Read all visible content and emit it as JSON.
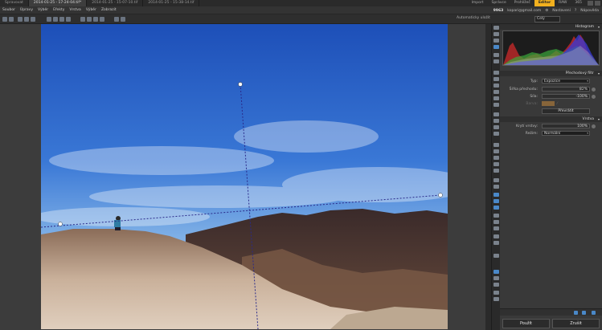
{
  "tabs": [
    {
      "label": "Spravovat",
      "active": false
    },
    {
      "label": "2014-01-25 - 17-24-04.tif*",
      "active": true
    },
    {
      "label": "2014-01-25 - 15-07-10.tif",
      "active": false
    },
    {
      "label": "2014-01-25 - 15-38-14.tif",
      "active": false
    }
  ],
  "modes": [
    {
      "label": "Import",
      "active": false
    },
    {
      "label": "Správce",
      "active": false
    },
    {
      "label": "Prohlížeč",
      "active": false
    },
    {
      "label": "Editor",
      "active": true
    },
    {
      "label": "RAW",
      "active": false
    },
    {
      "label": "365",
      "active": false
    }
  ],
  "menu": [
    "Soubor",
    "Úpravy",
    "Výběr",
    "Efekty",
    "Vrstva",
    "Výběr",
    "Zobrazit"
  ],
  "account": {
    "id": "9963",
    "email": "kopari@gmail.com",
    "settings": "Nastavení",
    "help": "Nápověda"
  },
  "toolbar": {
    "zoom_label": "Celý",
    "zoom_percent": "Automaticky uložit"
  },
  "histogram_title": "Histogram",
  "gradient_panel": {
    "title": "Přechodový filtr",
    "type_label": "Typ:",
    "type_value": "Expozice",
    "width_label": "Šířka přechodu:",
    "width_value": "82%",
    "strength_label": "Síla:",
    "strength_value": "-100%",
    "color_label": "Barva:",
    "apply_button": "Převrátit"
  },
  "layer_panel": {
    "title": "Vrstva",
    "opacity_label": "Krytí vrstvy:",
    "opacity_value": "100%",
    "mode_label": "Režim:",
    "mode_value": "Normální"
  },
  "buttons": {
    "apply": "Použít",
    "cancel": "Zrušit"
  },
  "gradient_fractions": {
    "width": 0.82,
    "strength": 1.0,
    "opacity": 1.0
  },
  "colors": {
    "active_mode": "#f2b01e",
    "accent": "#4a88c8",
    "guide": "#2a2a8a"
  }
}
